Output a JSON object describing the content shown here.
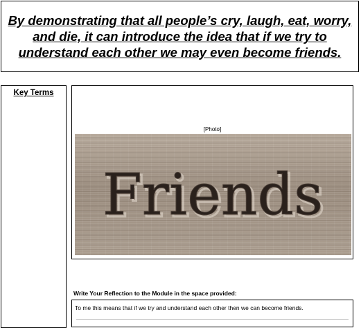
{
  "header": {
    "text": "By demonstrating that all people’s cry, laugh, eat, worry, and die, it can introduce the idea that if we try to understand each other we may even become friends."
  },
  "key_terms": {
    "title": "Key Terms"
  },
  "photo": {
    "caption": "[Photo]",
    "carved_word": "Friends"
  },
  "reflection": {
    "label": "Write Your Reflection to the Module in the space provided:",
    "text": "To me this means that if we try and understand each other then  we can become friends."
  }
}
